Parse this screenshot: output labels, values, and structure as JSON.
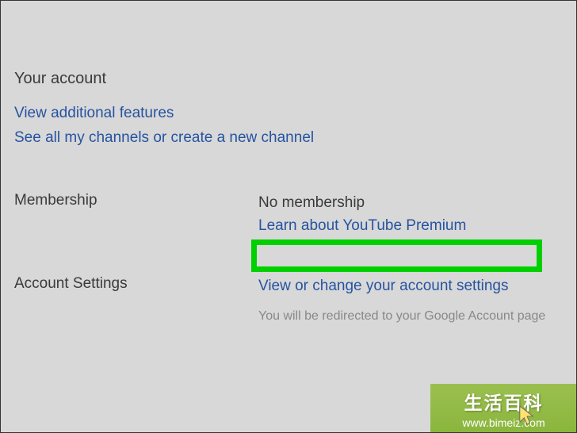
{
  "header": {
    "title": "Your account"
  },
  "links": {
    "additional_features": "View additional features",
    "see_channels": "See all my channels or create a new channel"
  },
  "membership": {
    "label": "Membership",
    "status": "No membership",
    "learn_link": "Learn about YouTube Premium"
  },
  "account_settings": {
    "label": "Account Settings",
    "view_link": "View or change your account settings",
    "redirect_note": "You will be redirected to your Google Account page"
  },
  "watermark": {
    "cn": "生活百科",
    "url": "www.bimeiz.com"
  }
}
